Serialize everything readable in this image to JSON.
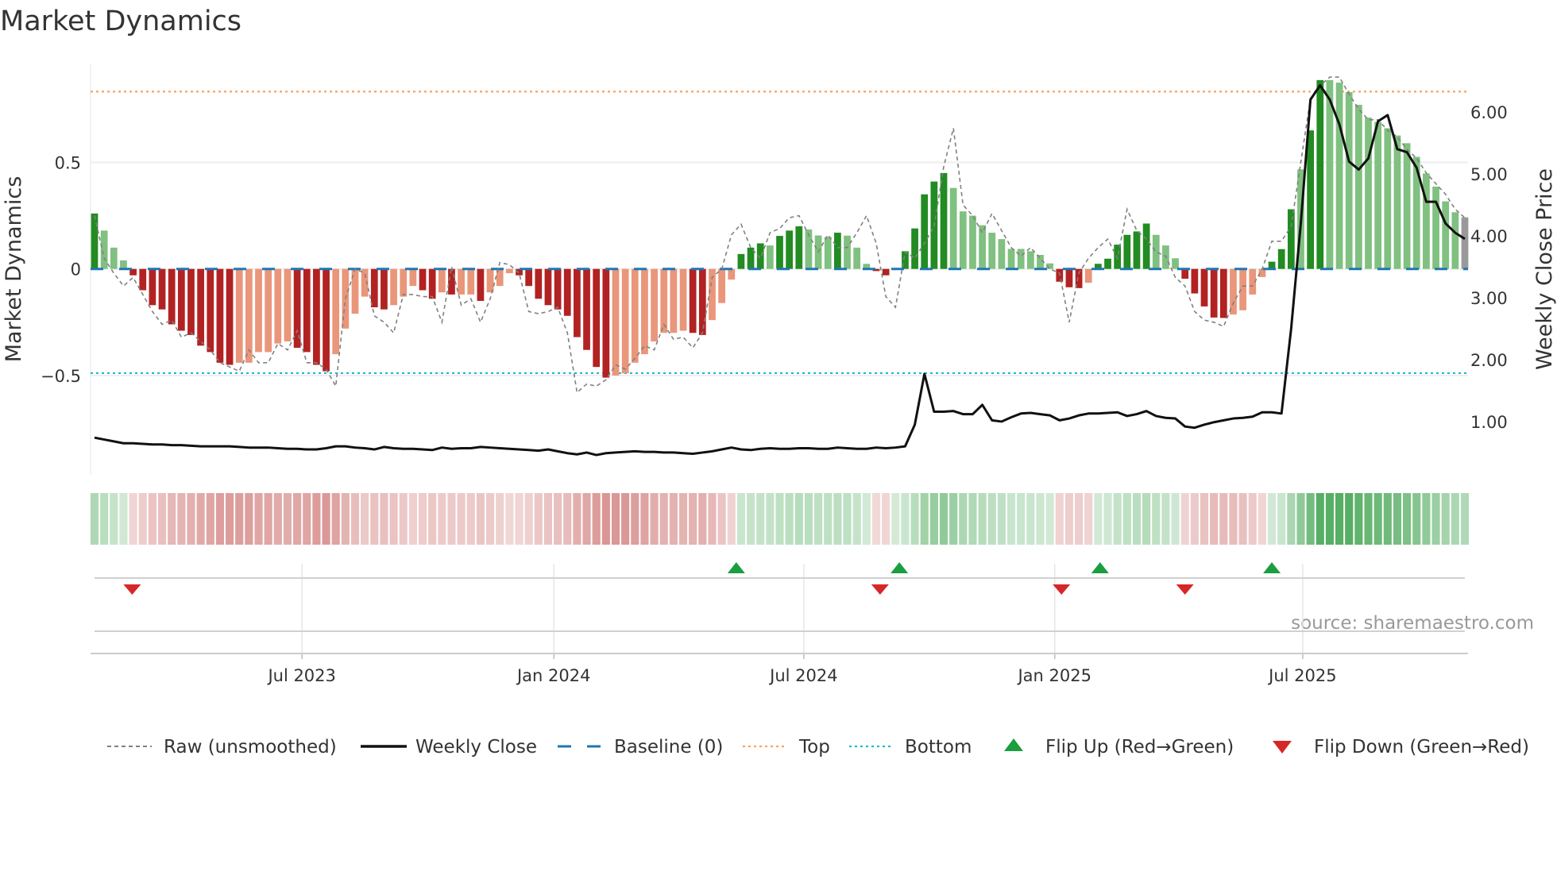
{
  "chart_data": {
    "type": "bar",
    "title": "Market Dynamics",
    "ylabel": "Market Dynamics",
    "ylabel_right": "Weekly Close Price",
    "source": "source: sharemaestro.com",
    "ylim": [
      -0.966,
      0.96
    ],
    "ylim_right": [
      0.14,
      6.77
    ],
    "yticks": [
      {
        "value": 0.5,
        "label": "0.5"
      },
      {
        "value": 0,
        "label": "0"
      },
      {
        "value": -0.5,
        "label": "−0.5"
      }
    ],
    "yticks_right": [
      {
        "value": 6,
        "label": "6.00"
      },
      {
        "value": 5,
        "label": "5.00"
      },
      {
        "value": 4,
        "label": "4.00"
      },
      {
        "value": 3,
        "label": "3.00"
      },
      {
        "value": 2,
        "label": "2.00"
      },
      {
        "value": 1,
        "label": "1.00"
      }
    ],
    "xticks": [
      {
        "week": 21.5,
        "label": "Jul 2023"
      },
      {
        "week": 47.6,
        "label": "Jan 2024"
      },
      {
        "week": 73.5,
        "label": "Jul 2024"
      },
      {
        "week": 99.5,
        "label": "Jan 2025"
      },
      {
        "week": 125.2,
        "label": "Jul 2025"
      }
    ],
    "top_level": 0.832,
    "bottom_level": -0.489,
    "baseline": 0,
    "colors": {
      "G": "#228b22",
      "g": "#80c080",
      "R": "#b22222",
      "r": "#e9967a",
      "raw": "#808080",
      "close": "#111111",
      "baseline": "#1f77b4",
      "top": "#f4a460",
      "bottom": "#17becf",
      "flip_up": "#1a9e3f",
      "flip_down": "#d62728"
    },
    "values": [
      0.26,
      0.18,
      0.1,
      0.04,
      -0.03,
      -0.1,
      -0.17,
      -0.19,
      -0.26,
      -0.29,
      -0.31,
      -0.36,
      -0.39,
      -0.44,
      -0.45,
      -0.44,
      -0.44,
      -0.39,
      -0.39,
      -0.35,
      -0.34,
      -0.37,
      -0.39,
      -0.45,
      -0.48,
      -0.4,
      -0.28,
      -0.21,
      -0.13,
      -0.18,
      -0.19,
      -0.17,
      -0.13,
      -0.08,
      -0.1,
      -0.14,
      -0.11,
      -0.12,
      -0.12,
      -0.12,
      -0.15,
      -0.11,
      -0.08,
      -0.02,
      -0.03,
      -0.08,
      -0.14,
      -0.17,
      -0.19,
      -0.22,
      -0.32,
      -0.38,
      -0.46,
      -0.51,
      -0.5,
      -0.49,
      -0.44,
      -0.4,
      -0.34,
      -0.3,
      -0.3,
      -0.29,
      -0.3,
      -0.31,
      -0.24,
      -0.16,
      -0.05,
      0.07,
      0.1,
      0.12,
      0.11,
      0.155,
      0.18,
      0.2,
      0.185,
      0.157,
      0.15,
      0.17,
      0.156,
      0.1,
      0.024,
      -0.01,
      -0.03,
      0.005,
      0.083,
      0.19,
      0.35,
      0.41,
      0.45,
      0.38,
      0.27,
      0.25,
      0.205,
      0.17,
      0.14,
      0.094,
      0.094,
      0.083,
      0.066,
      0.026,
      -0.06,
      -0.086,
      -0.09,
      -0.065,
      0.024,
      0.048,
      0.114,
      0.16,
      0.176,
      0.213,
      0.16,
      0.11,
      0.05,
      -0.046,
      -0.115,
      -0.176,
      -0.228,
      -0.23,
      -0.214,
      -0.194,
      -0.12,
      -0.038,
      0.034,
      0.093,
      0.28,
      0.467,
      0.65,
      0.886,
      0.886,
      0.874,
      0.83,
      0.77,
      0.71,
      0.69,
      0.66,
      0.626,
      0.59,
      0.526,
      0.448,
      0.386,
      0.317,
      0.266,
      0.242
    ],
    "bar_colors": "GgggRRRRRRRRRRRrrrrrrRRRRrrrrRRrrrRRrRrrRrrrRRRRRRRRRRrrrrrrrrRRrrrGGGgGGGgggGgggRRgGGGGGgggggggggggRRRrGGGGGGgggRRRRRrrrrGGGgGGgggggggggggggg",
    "raw": [
      0.25,
      0.05,
      -0.02,
      -0.08,
      -0.04,
      -0.12,
      -0.2,
      -0.26,
      -0.24,
      -0.32,
      -0.3,
      -0.34,
      -0.38,
      -0.44,
      -0.46,
      -0.48,
      -0.38,
      -0.44,
      -0.44,
      -0.35,
      -0.38,
      -0.29,
      -0.44,
      -0.44,
      -0.47,
      -0.55,
      -0.14,
      0.0,
      -0.02,
      -0.22,
      -0.25,
      -0.3,
      -0.12,
      -0.12,
      -0.13,
      -0.13,
      -0.25,
      0.01,
      -0.17,
      -0.14,
      -0.25,
      -0.14,
      0.03,
      0.02,
      -0.02,
      -0.2,
      -0.21,
      -0.2,
      -0.18,
      -0.3,
      -0.58,
      -0.54,
      -0.55,
      -0.52,
      -0.45,
      -0.47,
      -0.42,
      -0.36,
      -0.38,
      -0.26,
      -0.33,
      -0.32,
      -0.37,
      -0.3,
      -0.04,
      0.0,
      0.16,
      0.21,
      0.1,
      0.05,
      0.17,
      0.19,
      0.24,
      0.25,
      0.16,
      0.08,
      0.16,
      0.1,
      0.1,
      0.17,
      0.25,
      0.12,
      -0.13,
      -0.18,
      0.08,
      0.05,
      0.12,
      0.2,
      0.48,
      0.66,
      0.3,
      0.25,
      0.17,
      0.26,
      0.18,
      0.1,
      0.06,
      0.1,
      0.05,
      0.0,
      -0.02,
      -0.25,
      -0.02,
      0.05,
      0.1,
      0.14,
      0.05,
      0.28,
      0.18,
      0.14,
      0.08,
      0.06,
      -0.04,
      -0.08,
      -0.2,
      -0.24,
      -0.25,
      -0.27,
      -0.16,
      -0.08,
      -0.08,
      0.0,
      0.13,
      0.13,
      0.2,
      0.5,
      0.8,
      0.86,
      0.9,
      0.9,
      0.82,
      0.75,
      0.7,
      0.7,
      0.65,
      0.62,
      0.56,
      0.52,
      0.45,
      0.4,
      0.35,
      0.28,
      0.24
    ],
    "weekly_close": [
      0.74,
      0.71,
      0.68,
      0.65,
      0.65,
      0.64,
      0.63,
      0.63,
      0.62,
      0.62,
      0.61,
      0.6,
      0.6,
      0.6,
      0.6,
      0.59,
      0.58,
      0.58,
      0.58,
      0.57,
      0.56,
      0.56,
      0.55,
      0.55,
      0.57,
      0.6,
      0.6,
      0.58,
      0.57,
      0.55,
      0.59,
      0.57,
      0.56,
      0.56,
      0.55,
      0.54,
      0.58,
      0.56,
      0.57,
      0.57,
      0.59,
      0.58,
      0.57,
      0.56,
      0.55,
      0.54,
      0.53,
      0.55,
      0.52,
      0.49,
      0.47,
      0.5,
      0.46,
      0.49,
      0.5,
      0.51,
      0.52,
      0.51,
      0.51,
      0.5,
      0.5,
      0.49,
      0.48,
      0.5,
      0.52,
      0.55,
      0.58,
      0.55,
      0.54,
      0.56,
      0.57,
      0.56,
      0.56,
      0.57,
      0.57,
      0.56,
      0.56,
      0.58,
      0.57,
      0.56,
      0.56,
      0.58,
      0.57,
      0.58,
      0.6,
      0.95,
      1.77,
      1.16,
      1.16,
      1.17,
      1.12,
      1.12,
      1.27,
      1.02,
      1.0,
      1.07,
      1.13,
      1.14,
      1.12,
      1.1,
      1.02,
      1.05,
      1.1,
      1.13,
      1.13,
      1.14,
      1.15,
      1.09,
      1.12,
      1.17,
      1.09,
      1.06,
      1.05,
      0.92,
      0.9,
      0.95,
      0.99,
      1.02,
      1.05,
      1.06,
      1.08,
      1.15,
      1.15,
      1.13,
      2.5,
      4.2,
      6.2,
      6.43,
      6.2,
      5.8,
      5.2,
      5.07,
      5.25,
      5.85,
      5.95,
      5.4,
      5.35,
      5.1,
      4.55,
      4.55,
      4.2,
      4.05,
      3.95
    ],
    "flip_up_weeks": [
      66.5,
      83.4,
      104.2,
      122
    ],
    "flip_down_weeks": [
      3.9,
      81.4,
      100.2,
      113
    ],
    "legend": {
      "placement": "bottom",
      "items": [
        {
          "label": "Raw (unsmoothed)",
          "kind": "raw"
        },
        {
          "label": "Weekly Close",
          "kind": "close"
        },
        {
          "label": "Baseline (0)",
          "kind": "baseline"
        },
        {
          "label": "Top",
          "kind": "top"
        },
        {
          "label": "Bottom",
          "kind": "bottom"
        },
        {
          "label": "Flip Up (Red→Green)",
          "kind": "flip_up"
        },
        {
          "label": "Flip Down (Green→Red)",
          "kind": "flip_down"
        }
      ]
    }
  }
}
